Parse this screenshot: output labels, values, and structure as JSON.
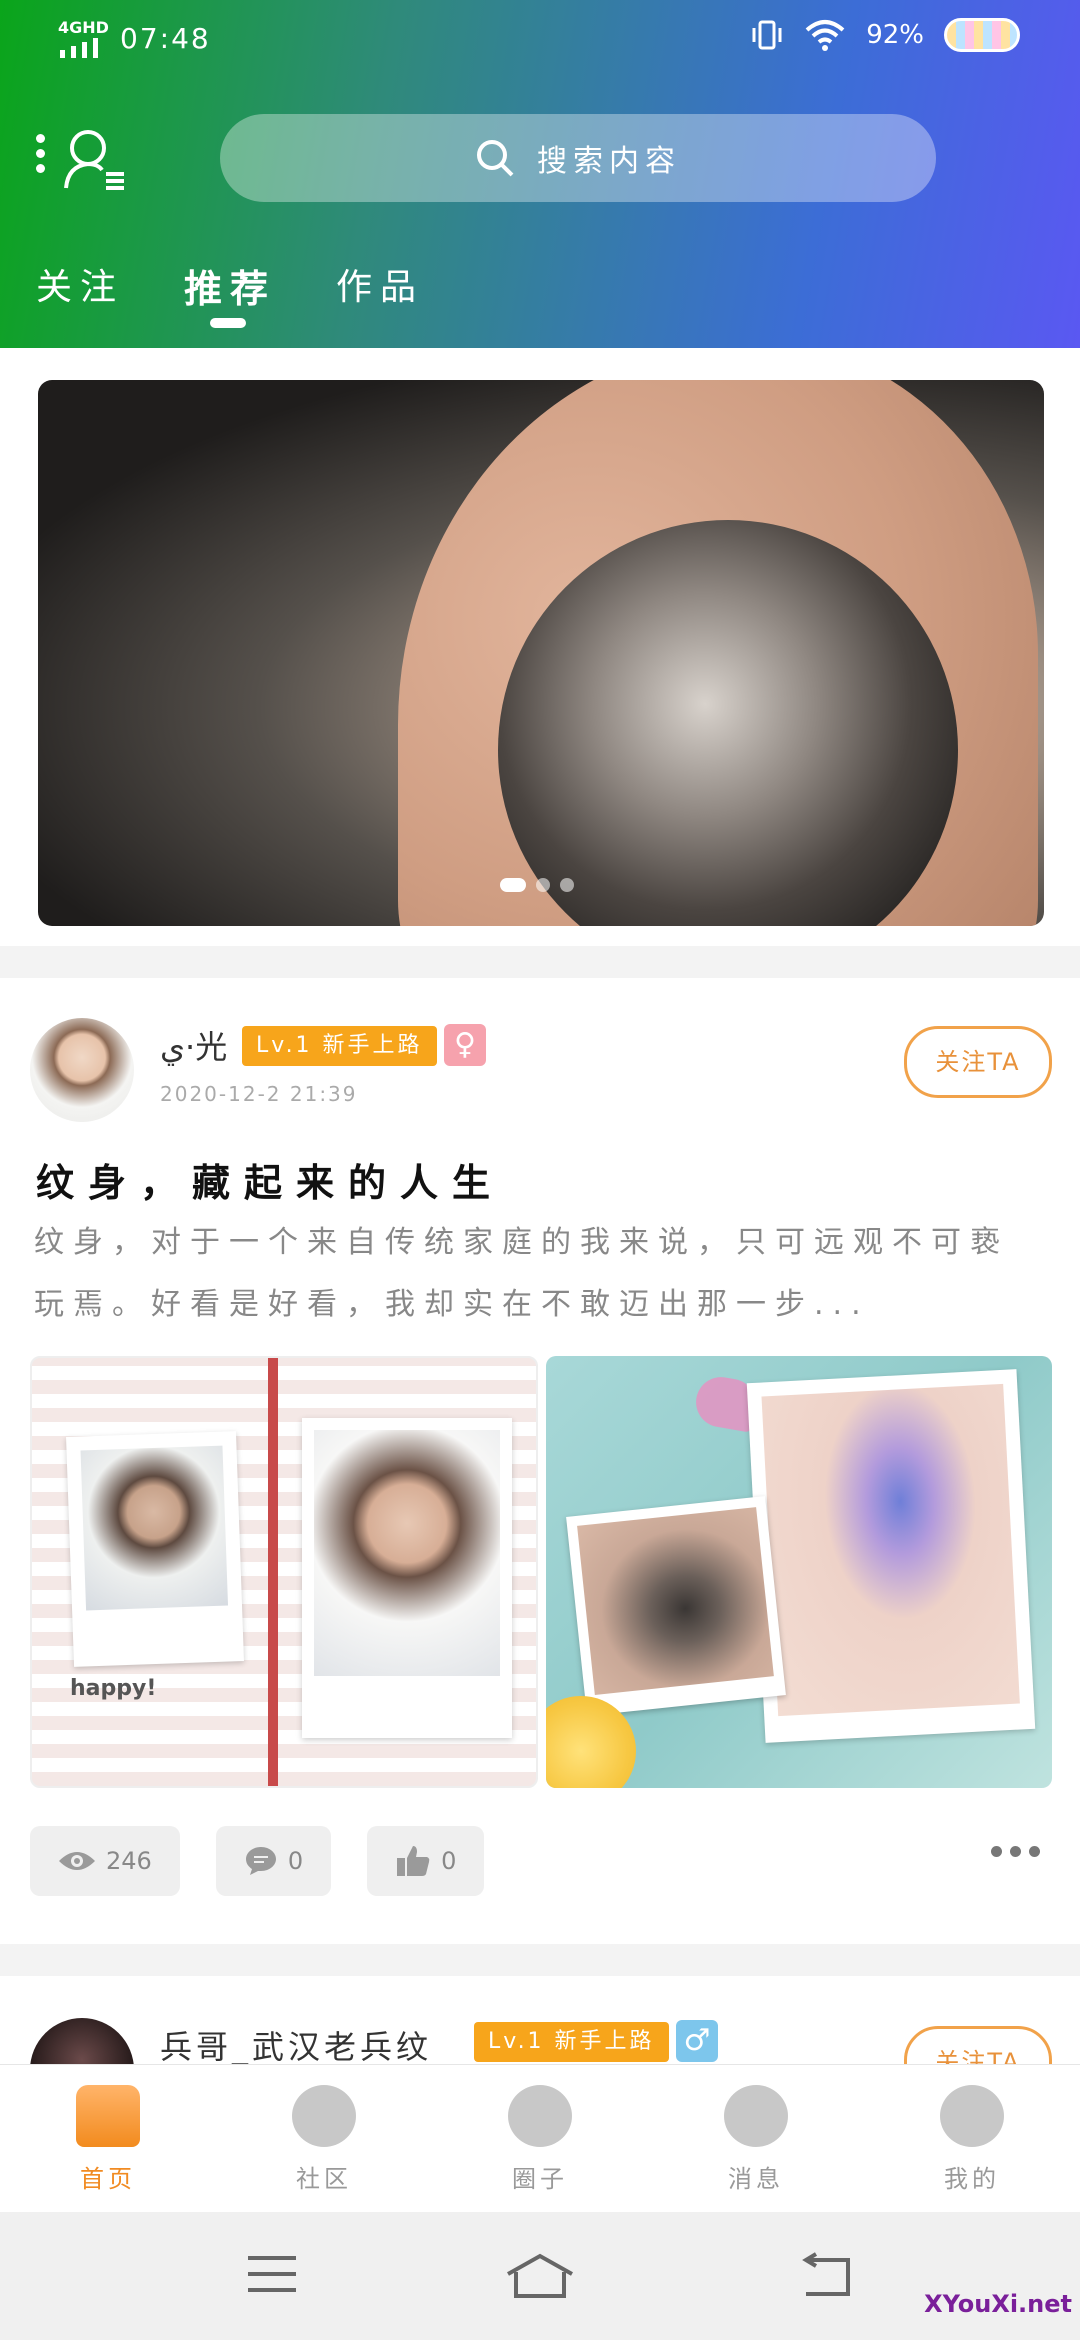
{
  "status": {
    "network": "4GHD",
    "time": "07:48",
    "battery_percent": "92%"
  },
  "header": {
    "search_placeholder": "搜索内容",
    "tabs": [
      {
        "label": "关注",
        "active": false
      },
      {
        "label": "推荐",
        "active": true
      },
      {
        "label": "作品",
        "active": false
      }
    ]
  },
  "banner": {
    "slide_count": 3,
    "active_slide": 1
  },
  "posts": [
    {
      "username": "ي·光",
      "level": "Lv.1 新手上路",
      "gender_symbol": "♀",
      "date": "2020-12-2 21:39",
      "follow_label": "关注TA",
      "title": "纹身，藏起来的人生",
      "excerpt": "纹身，对于一个来自传统家庭的我来说，只可远观不可亵玩焉。好看是好看，我却实在不敢迈出那一步...",
      "image1_text": "happy!",
      "views": "246",
      "comments": "0",
      "likes": "0"
    },
    {
      "username": "兵哥_武汉老兵纹",
      "level": "Lv.1 新手上路",
      "gender_symbol": "♂",
      "follow_label": "关注TA"
    }
  ],
  "bottom_nav": [
    {
      "label": "首页",
      "icon": "home-icon",
      "active": true
    },
    {
      "label": "社区",
      "icon": "community-icon",
      "active": false
    },
    {
      "label": "圈子",
      "icon": "circle-icon",
      "active": false
    },
    {
      "label": "消息",
      "icon": "message-icon",
      "active": false
    },
    {
      "label": "我的",
      "icon": "profile-icon",
      "active": false
    }
  ],
  "watermark": "XYouXi.net",
  "colors": {
    "accent_orange": "#f18b22",
    "level_badge": "#f7a51b",
    "header_start": "#0aa51a",
    "header_end": "#5a58f2"
  }
}
